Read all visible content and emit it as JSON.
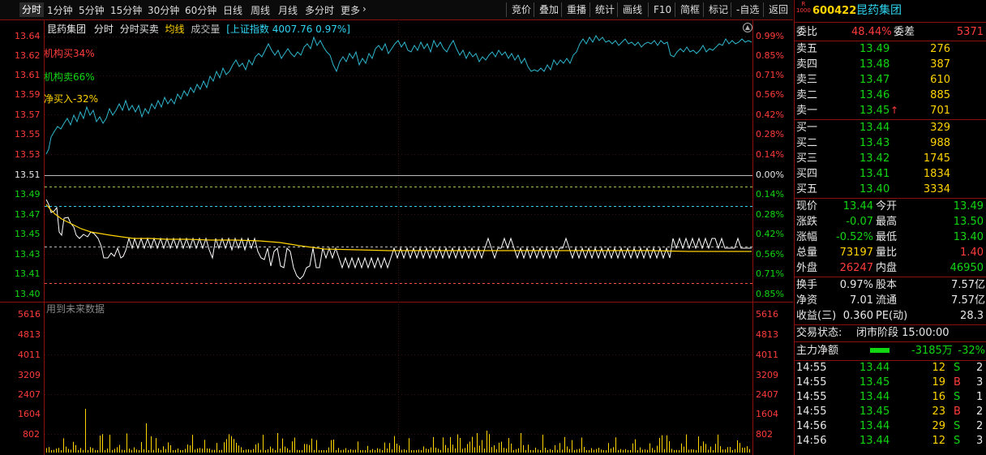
{
  "toolbar": {
    "periods": [
      "分时",
      "1分钟",
      "5分钟",
      "15分钟",
      "30分钟",
      "60分钟",
      "日线",
      "周线",
      "月线",
      "多分时",
      "更多"
    ],
    "tools": [
      "竞价",
      "叠加",
      "重播",
      "统计",
      "画线",
      "F10",
      "简框",
      "标记",
      "-自选",
      "返回"
    ]
  },
  "legend": {
    "name": "昆药集团",
    "mode": "分时",
    "mode2": "分时买卖",
    "avg_line": "均线",
    "volume": "成交量",
    "index": "[上证指数 4007.76 0.97%]"
  },
  "overlay": {
    "inst_buy": "机构买34%",
    "inst_sell": "机构卖66%",
    "net_buy": "净买入-32%",
    "future_data": "用到未来数据"
  },
  "price_axis": {
    "left": [
      "13.64",
      "13.62",
      "13.61",
      "13.59",
      "13.57",
      "13.55",
      "13.53",
      "13.51",
      "13.49",
      "13.47",
      "13.45",
      "13.43",
      "13.41",
      "13.40"
    ],
    "right": [
      "0.99%",
      "0.85%",
      "0.71%",
      "0.56%",
      "0.42%",
      "0.28%",
      "0.14%",
      "0.00%",
      "0.14%",
      "0.28%",
      "0.42%",
      "0.56%",
      "0.71%",
      "0.85%"
    ]
  },
  "volume_axis": [
    "5616",
    "4813",
    "4011",
    "3209",
    "2407",
    "1604",
    "802"
  ],
  "stock": {
    "code": "600422",
    "name": "昆药集团",
    "badge_top": "R",
    "badge_bottom": "1000"
  },
  "commission": {
    "ratio_label": "委比",
    "ratio": "48.44%",
    "diff_label": "委差",
    "diff": "5371"
  },
  "asks": [
    {
      "label": "卖五",
      "price": "13.49",
      "vol": "276"
    },
    {
      "label": "卖四",
      "price": "13.48",
      "vol": "387"
    },
    {
      "label": "卖三",
      "price": "13.47",
      "vol": "610"
    },
    {
      "label": "卖二",
      "price": "13.46",
      "vol": "885"
    },
    {
      "label": "卖一",
      "price": "13.45",
      "vol": "701"
    }
  ],
  "bids": [
    {
      "label": "买一",
      "price": "13.44",
      "vol": "329"
    },
    {
      "label": "买二",
      "price": "13.43",
      "vol": "988"
    },
    {
      "label": "买三",
      "price": "13.42",
      "vol": "1745"
    },
    {
      "label": "买四",
      "price": "13.41",
      "vol": "1834"
    },
    {
      "label": "买五",
      "price": "13.40",
      "vol": "3334"
    }
  ],
  "quote": [
    {
      "l1": "现价",
      "v1": "13.44",
      "l2": "今开",
      "v2": "13.49"
    },
    {
      "l1": "涨跌",
      "v1": "-0.07",
      "l2": "最高",
      "v2": "13.50"
    },
    {
      "l1": "涨幅",
      "v1": "-0.52%",
      "l2": "最低",
      "v2": "13.40"
    },
    {
      "l1": "总量",
      "v1": "73197",
      "l2": "量比",
      "v2": "1.40"
    },
    {
      "l1": "外盘",
      "v1": "26247",
      "l2": "内盘",
      "v2": "46950"
    }
  ],
  "fund": [
    {
      "l1": "换手",
      "v1": "0.97%",
      "l2": "股本",
      "v2": "7.57亿"
    },
    {
      "l1": "净资",
      "v1": "7.01",
      "l2": "流通",
      "v2": "7.57亿"
    },
    {
      "l1": "收益(三)",
      "v1": "0.360",
      "l2": "PE(动)",
      "v2": "28.3"
    }
  ],
  "status": {
    "label": "交易状态:",
    "value": "闭市阶段 15:00:00"
  },
  "main_force": {
    "label": "主力净额",
    "amount": "-3185万",
    "pct": "-32%"
  },
  "ticks": [
    {
      "time": "14:55",
      "price": "13.44",
      "vol": "12",
      "side": "S",
      "n": "2"
    },
    {
      "time": "14:55",
      "price": "13.45",
      "vol": "19",
      "side": "B",
      "n": "3"
    },
    {
      "time": "14:55",
      "price": "13.44",
      "vol": "16",
      "side": "S",
      "n": "1"
    },
    {
      "time": "14:55",
      "price": "13.45",
      "vol": "23",
      "side": "B",
      "n": "2"
    },
    {
      "time": "14:56",
      "price": "13.44",
      "vol": "29",
      "side": "S",
      "n": "2"
    },
    {
      "time": "14:56",
      "price": "13.44",
      "vol": "12",
      "side": "S",
      "n": "3"
    }
  ],
  "colors": {
    "up": "#ff3b3b",
    "down": "#13d613",
    "price_line": "#2fb8cf",
    "avg_line": "#ffd400",
    "frame": "#8a1010"
  }
}
